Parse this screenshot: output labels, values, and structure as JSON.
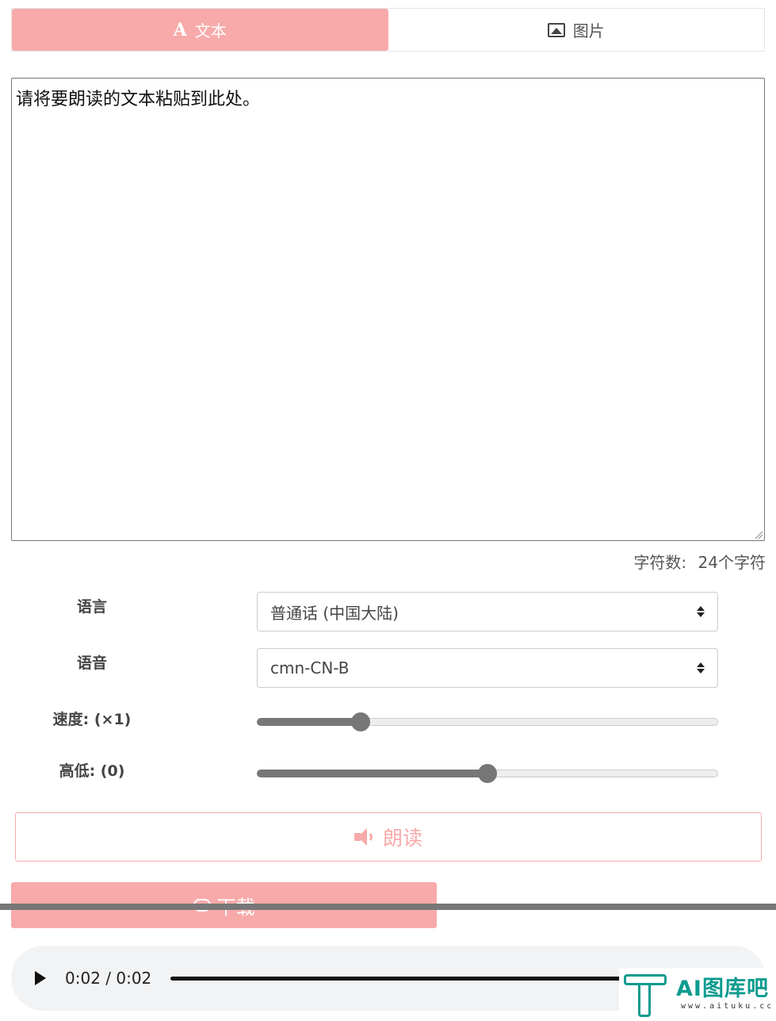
{
  "tabs": [
    {
      "icon": "text-A-icon",
      "label": "文本",
      "active": true
    },
    {
      "icon": "image-icon",
      "label": "图片",
      "active": false
    }
  ],
  "textarea": {
    "value": "请将要朗读的文本粘贴到此处。"
  },
  "charcount": {
    "label": "字符数:",
    "value": "24个字符"
  },
  "form": {
    "language": {
      "label": "语言",
      "value": "普通话 (中国大陆)"
    },
    "voice": {
      "label": "语音",
      "value": "cmn-CN-B"
    },
    "speed": {
      "label": "速度: (×1)",
      "level": 0.225
    },
    "pitch": {
      "label": "高低: (0)",
      "level": 0.5
    }
  },
  "read_button": {
    "label": "朗读"
  },
  "download_button": {
    "label": "下载"
  },
  "audio": {
    "time": "0:02 / 0:02"
  },
  "watermark": {
    "text": "AI图库吧",
    "url": "www.aituku.cc"
  },
  "colors": {
    "accent": "#f8aaaa",
    "slider": "#777777",
    "watermark": "#0d9b8f"
  }
}
